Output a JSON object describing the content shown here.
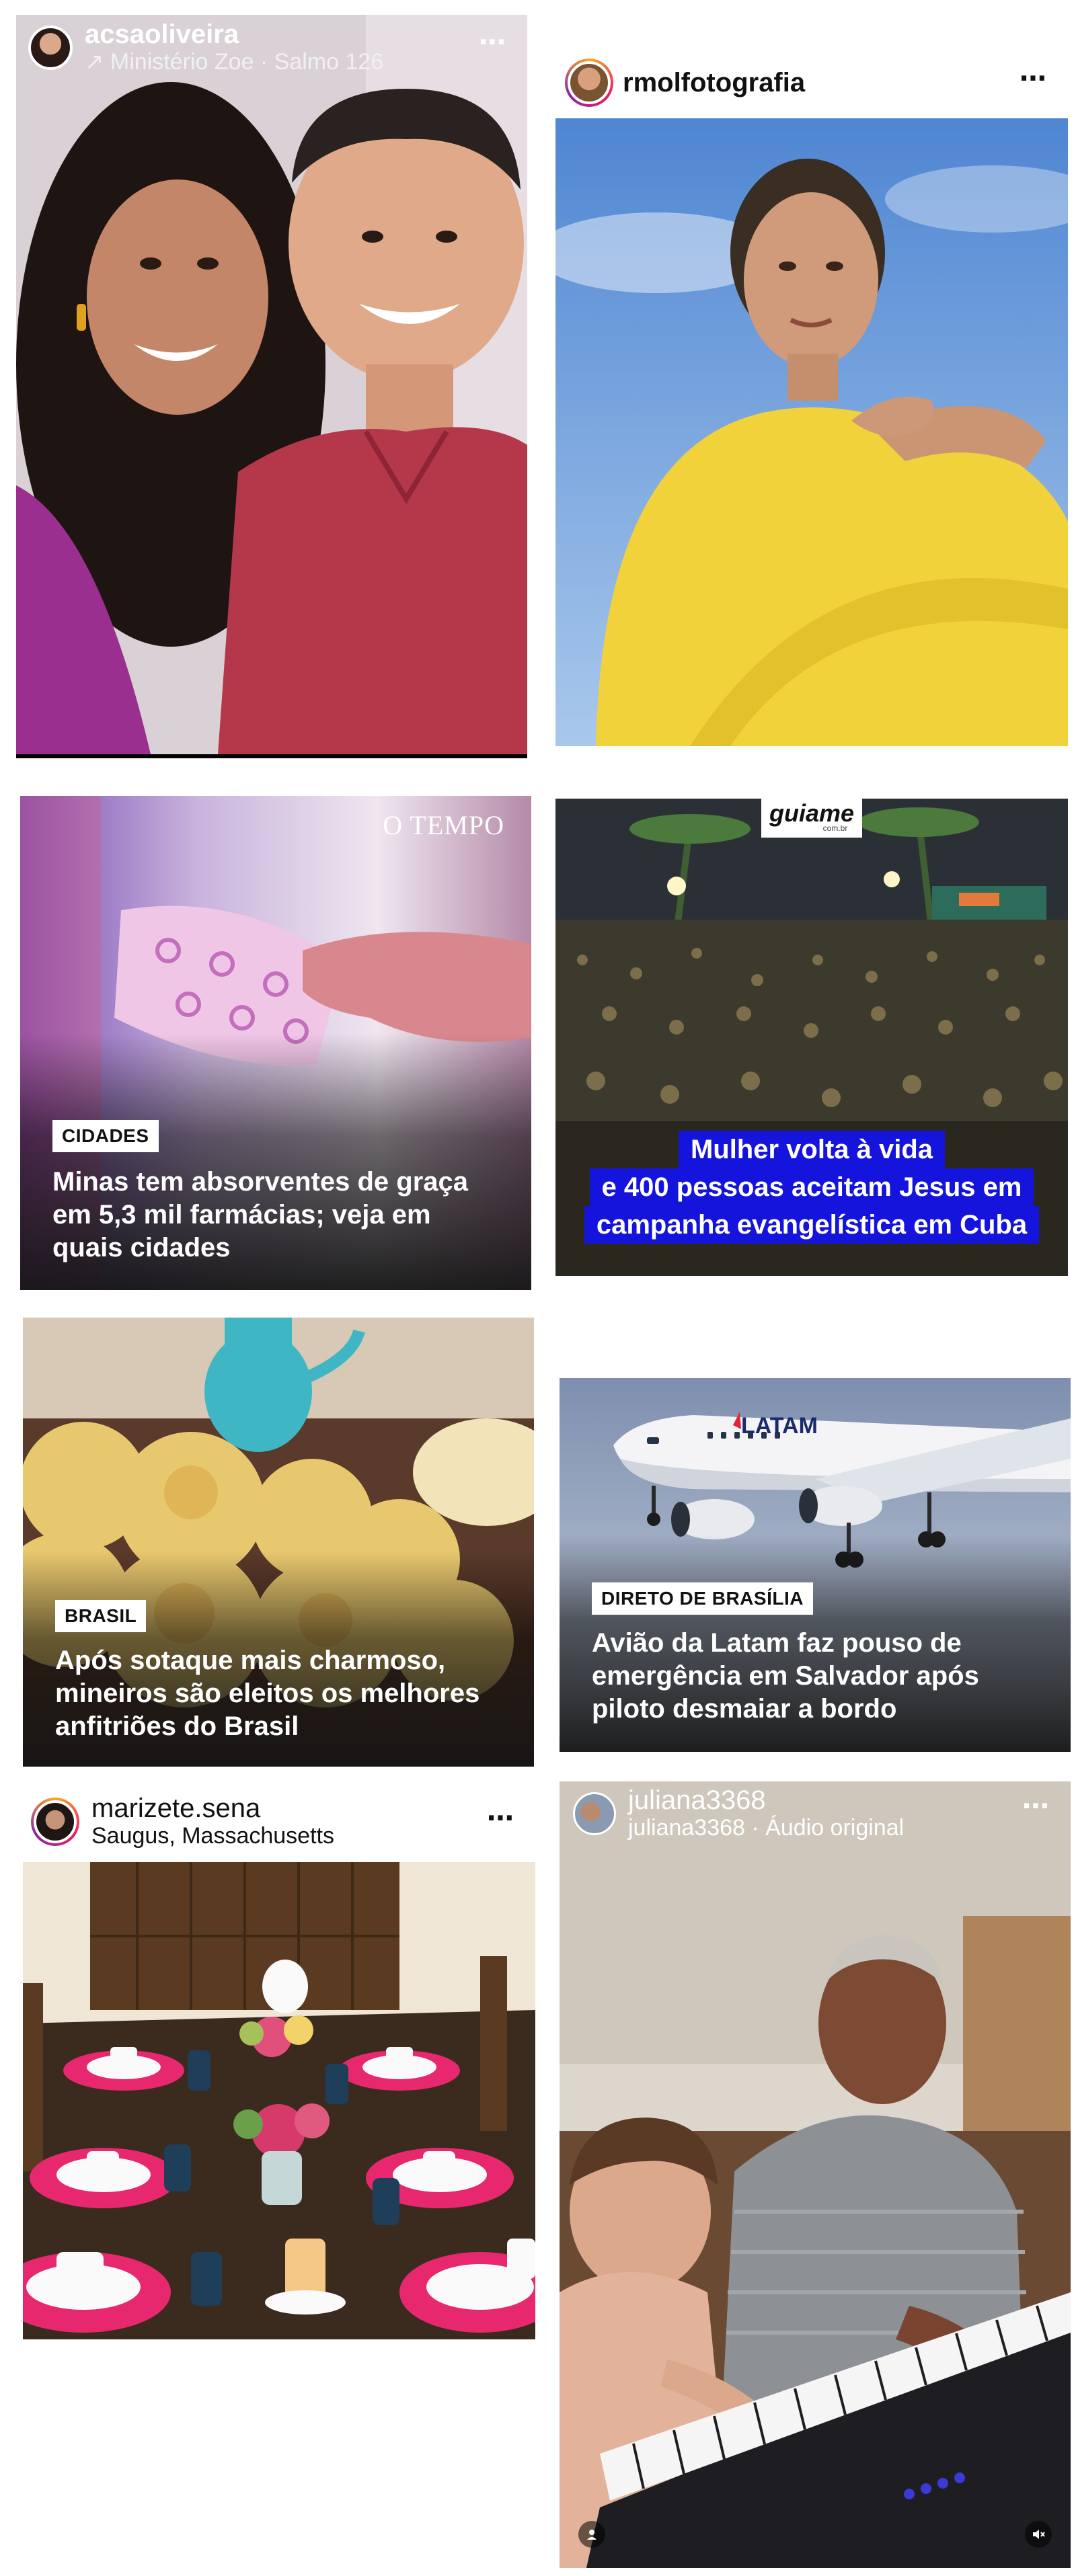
{
  "posts": [
    {
      "username": "acsaoliveira",
      "subtitle": "↗ Ministério Zoe · Salmo 126",
      "more_icon": "more-horizontal-icon"
    },
    {
      "username": "rmolfotografia",
      "more_icon": "more-horizontal-icon"
    },
    {
      "brand": "O TEMPO",
      "tag": "CIDADES",
      "headline": "Minas tem absorventes de graça em 5,3 mil farmácias; veja em quais cidades"
    },
    {
      "brand": "guiame",
      "brand_small": "com.br",
      "caption_lines": [
        "Mulher volta à vida",
        "e 400 pessoas aceitam Jesus em",
        "campanha evangelística em Cuba"
      ]
    },
    {
      "tag": "BRASIL",
      "headline": "Após sotaque mais charmoso, mineiros são eleitos os melhores anfitriões do Brasil"
    },
    {
      "tag": "DIRETO DE BRASÍLIA",
      "headline": "Avião da Latam faz pouso de emergência em Salvador após piloto desmaiar a bordo",
      "plane_text": "LATAM"
    },
    {
      "username": "marizete.sena",
      "subtitle": "Saugus, Massachusetts",
      "more_icon": "more-horizontal-icon"
    },
    {
      "username": "juliana3368",
      "subtitle": "juliana3368 · Áudio original",
      "more_icon": "more-horizontal-icon",
      "user_icon": "user-icon",
      "mute_icon": "muted-speaker-icon"
    }
  ],
  "colors": {
    "news_bg": "#1c1c1c",
    "caption_blue": "#1414dc",
    "table_pink": "#e8286e",
    "dress_yellow": "#f2d23b",
    "sky_blue": "#5b8fd6"
  }
}
